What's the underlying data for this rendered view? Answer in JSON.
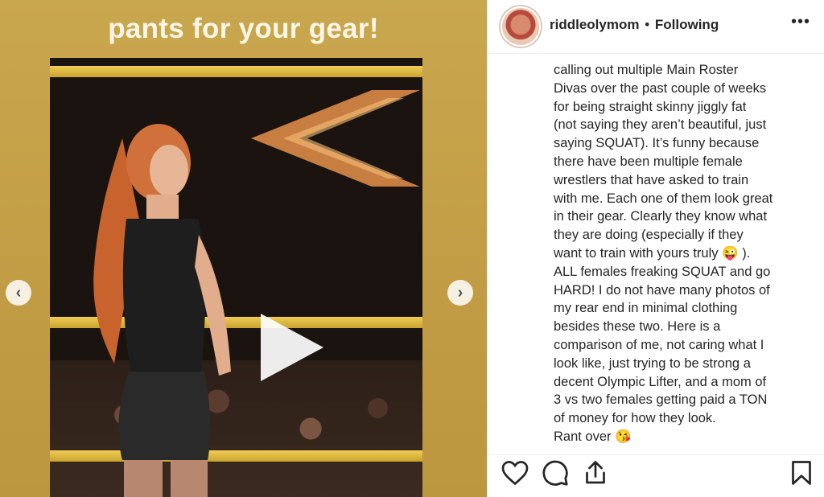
{
  "media": {
    "caption": "pants for your gear!",
    "play_icon": "play-icon",
    "prev_icon": "chevron-left-icon",
    "next_icon": "chevron-right-icon",
    "prev_glyph": "‹",
    "next_glyph": "›"
  },
  "post": {
    "username": "riddleolymom",
    "separator": "•",
    "follow_status": "Following",
    "more_label": "•••",
    "text_lines": [
      "calling out multiple Main Roster",
      "Divas over the past couple of weeks",
      "for being straight skinny jiggly fat",
      "(not saying they aren’t beautiful, just",
      "saying SQUAT). It’s funny because",
      "there have been multiple female",
      "wrestlers that have asked to train",
      "with me. Each one of them look great",
      "in their gear. Clearly they know what",
      "they are doing (especially if they",
      "want to train with yours truly 😜 ).",
      "ALL females freaking SQUAT and go",
      "HARD! I do not have many photos of",
      "my rear end in minimal clothing",
      "besides these two. Here is a",
      "comparison of me, not caring what I",
      "look like, just trying to be strong a",
      "decent Olympic Lifter, and a mom of",
      "3 vs two females getting paid a TON",
      "of money for how they look.",
      "Rant over 😘"
    ]
  },
  "actions": {
    "like_icon": "heart-icon",
    "comment_icon": "comment-icon",
    "share_icon": "share-icon",
    "save_icon": "bookmark-icon"
  },
  "colors": {
    "media_background": "#c6a34a",
    "text": "#262626",
    "caption": "#fff6e6"
  }
}
